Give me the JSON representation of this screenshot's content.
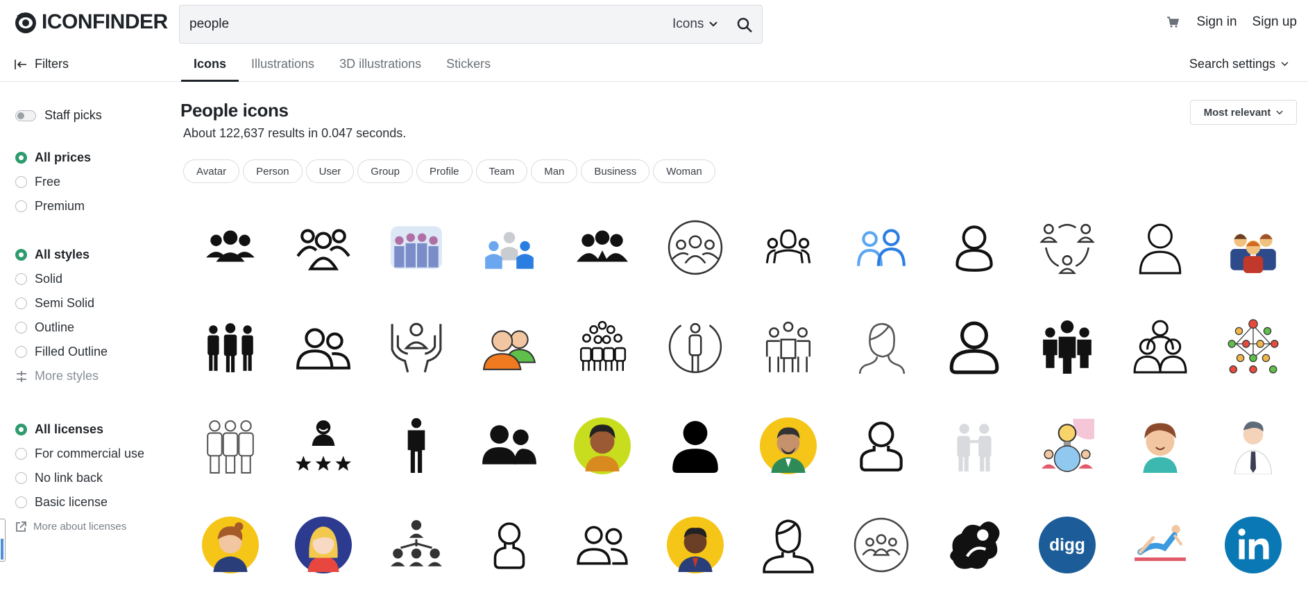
{
  "header": {
    "logo_text": "ICONFINDER",
    "search_value": "people",
    "search_type": "Icons",
    "sign_in": "Sign in",
    "sign_up": "Sign up"
  },
  "subnav": {
    "filters_label": "Filters",
    "tabs": [
      {
        "label": "Icons",
        "active": true
      },
      {
        "label": "Illustrations",
        "active": false
      },
      {
        "label": "3D illustrations",
        "active": false
      },
      {
        "label": "Stickers",
        "active": false
      }
    ],
    "search_settings": "Search settings"
  },
  "sidebar": {
    "staff_picks": "Staff picks",
    "prices": [
      "All prices",
      "Free",
      "Premium"
    ],
    "styles": [
      "All styles",
      "Solid",
      "Semi Solid",
      "Outline",
      "Filled Outline"
    ],
    "more_styles": "More styles",
    "licenses": [
      "All licenses",
      "For commercial use",
      "No link back",
      "Basic license"
    ],
    "more_licenses": "More about licenses"
  },
  "main": {
    "title": "People icons",
    "result_count": "About 122,637 results in 0.047 seconds.",
    "sort_label": "Most relevant",
    "chips": [
      "Avatar",
      "Person",
      "User",
      "Group",
      "Profile",
      "Team",
      "Man",
      "Business",
      "Woman"
    ]
  },
  "colors": {
    "accent_green": "#2e9b6e",
    "icon_black": "#111111",
    "blue_icon": "#2a7de1",
    "digg_blue": "#1c5d99",
    "linkedin_blue": "#0a78b5",
    "yellow_avatar": "#f5c518"
  },
  "icons": [
    [
      "group-solid-icon",
      "group-outline-icon",
      "crowd-colored-icon",
      "team-flat-blue-icon",
      "group-silhouette-icon",
      "team-circle-outline-icon",
      "group-line-icon",
      "users-blue-outline-icon",
      "user-outline-icon",
      "network-people-icon",
      "user-thin-outline-icon",
      "business-team-colored-icon"
    ],
    [
      "three-men-solid-icon",
      "two-users-outline-icon",
      "hands-person-outline-icon",
      "users-colored-icon",
      "crowd-outline-icon",
      "person-circle-outline-icon",
      "team-line-icon",
      "woman-outline-icon",
      "user-bold-outline-icon",
      "team-solid-icon",
      "three-users-outline-icon",
      "network-colored-icon"
    ],
    [
      "three-men-outline-icon",
      "rating-person-icon",
      "man-standing-icon",
      "two-people-solid-icon",
      "woman-avatar-yellow-icon",
      "user-solid-icon",
      "man-avatar-yellow-icon",
      "user-line-icon",
      "couple-light-icon",
      "idea-people-icon",
      "boy-avatar-icon",
      "businessman-icon"
    ],
    [
      "woman-avatar-icon",
      "girl-avatar-blue-icon",
      "hierarchy-icon",
      "user-thin-icon",
      "two-users-line-icon",
      "man-avatar-icon",
      "man-outline-icon",
      "group-circle-icon",
      "splash-person-icon",
      "digg-icon",
      "yoga-person-icon",
      "linkedin-icon"
    ]
  ]
}
